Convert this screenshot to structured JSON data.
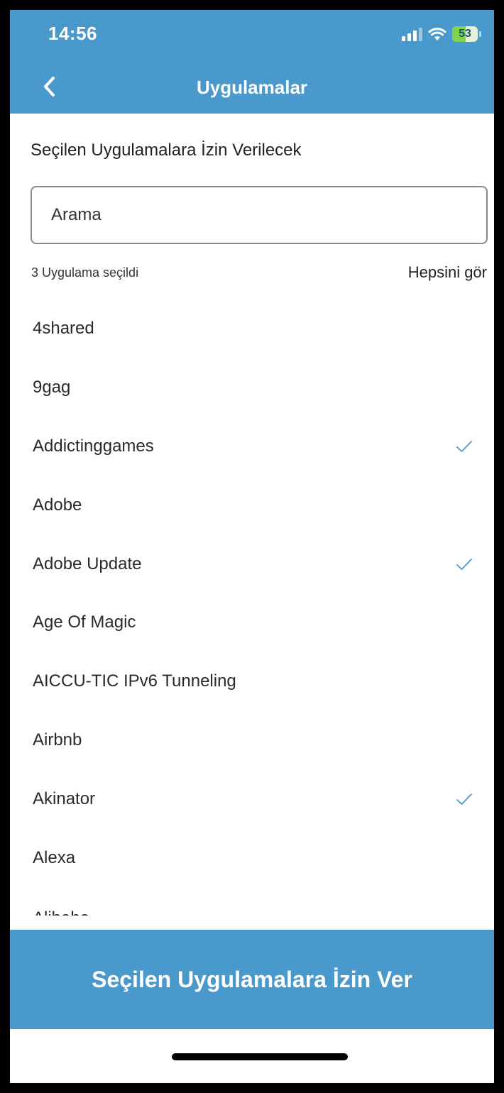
{
  "status_bar": {
    "time": "14:56",
    "battery": "53",
    "icons": [
      "signal-icon",
      "wifi-icon",
      "battery-icon"
    ]
  },
  "nav": {
    "title": "Uygulamalar",
    "back_icon": "chevron-left-icon"
  },
  "subtitle": "Seçilen Uygulamalara İzin Verilecek",
  "search": {
    "placeholder": "Arama",
    "value": ""
  },
  "selection": {
    "count_text": "3 Uygulama seçildi",
    "see_all": "Hepsini gör"
  },
  "apps": [
    {
      "name": "4shared",
      "selected": false
    },
    {
      "name": "9gag",
      "selected": false
    },
    {
      "name": "Addictinggames",
      "selected": true
    },
    {
      "name": "Adobe",
      "selected": false
    },
    {
      "name": "Adobe Update",
      "selected": true
    },
    {
      "name": "Age Of Magic",
      "selected": false
    },
    {
      "name": "AICCU-TIC IPv6 Tunneling",
      "selected": false
    },
    {
      "name": "Airbnb",
      "selected": false
    },
    {
      "name": "Akinator",
      "selected": true
    },
    {
      "name": "Alexa",
      "selected": false
    },
    {
      "name": "Alibaba",
      "selected": false
    }
  ],
  "cta_label": "Seçilen Uygulamalara İzin Ver",
  "colors": {
    "primary": "#4a99cc",
    "check": "#4a99cc"
  }
}
